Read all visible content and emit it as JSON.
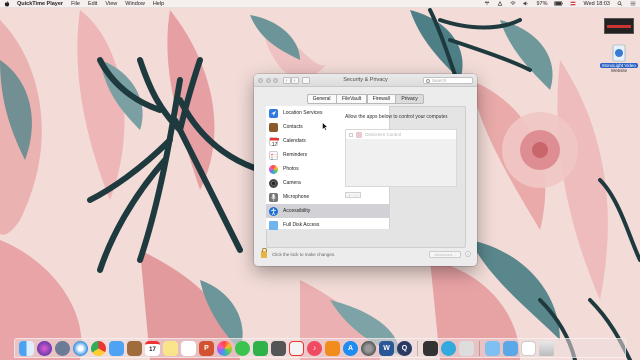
{
  "menubar": {
    "app_name": "QuickTime Player",
    "menus": [
      "File",
      "Edit",
      "View",
      "Window",
      "Help"
    ],
    "battery": "97%",
    "clock": "Wed 18:03"
  },
  "desktop": {
    "thumb_label": "",
    "icon_label_1": "MonoLight Video",
    "icon_label_2": "Website"
  },
  "window": {
    "title": "Security & Privacy",
    "search_placeholder": "Search",
    "tabs": [
      {
        "label": "General",
        "active": false
      },
      {
        "label": "FileVault",
        "active": false
      },
      {
        "label": "Firewall",
        "active": false
      },
      {
        "label": "Privacy",
        "active": true
      }
    ],
    "privacy_items": [
      {
        "label": "Location Services",
        "icon": "location-icon",
        "selected": false
      },
      {
        "label": "Contacts",
        "icon": "contacts-icon",
        "selected": false
      },
      {
        "label": "Calendars",
        "icon": "calendar-icon",
        "selected": false
      },
      {
        "label": "Reminders",
        "icon": "reminders-icon",
        "selected": false
      },
      {
        "label": "Photos",
        "icon": "photos-icon",
        "selected": false
      },
      {
        "label": "Camera",
        "icon": "camera-icon",
        "selected": false
      },
      {
        "label": "Microphone",
        "icon": "microphone-icon",
        "selected": false
      },
      {
        "label": "Accessibility",
        "icon": "accessibility-icon",
        "selected": true
      },
      {
        "label": "Full Disk Access",
        "icon": "folder-icon",
        "selected": false
      }
    ],
    "detail_text": "Allow the apps below to control your computer.",
    "apps": [
      {
        "name": "OnScreen Control",
        "checked": false
      }
    ],
    "lock_text": "Click the lock to make changes.",
    "advanced_label": "Advanced...",
    "help_label": "?"
  },
  "colors": {
    "selected_row": "#d2d2d6",
    "accessibility_blue": "#1f6fd6",
    "lock_gold": "#e5b544"
  },
  "dock": {
    "icons": [
      "finder-icon",
      "siri-icon",
      "launchpad-icon",
      "safari-icon",
      "chrome-icon",
      "mail-icon",
      "contacts-icon",
      "calendar-icon",
      "notes-icon",
      "reminders-icon",
      "powerpoint-icon",
      "photos-icon",
      "messages-icon",
      "facetime-icon",
      "chess-icon",
      "news-icon",
      "music-icon",
      "books-icon",
      "appstore-icon",
      "system-preferences-icon",
      "word-icon",
      "quicktime-icon",
      "terminal-icon",
      "remote-icon",
      "preview-icon",
      "finder-folder-icon",
      "downloads-icon",
      "document-icon",
      "trash-icon"
    ]
  }
}
